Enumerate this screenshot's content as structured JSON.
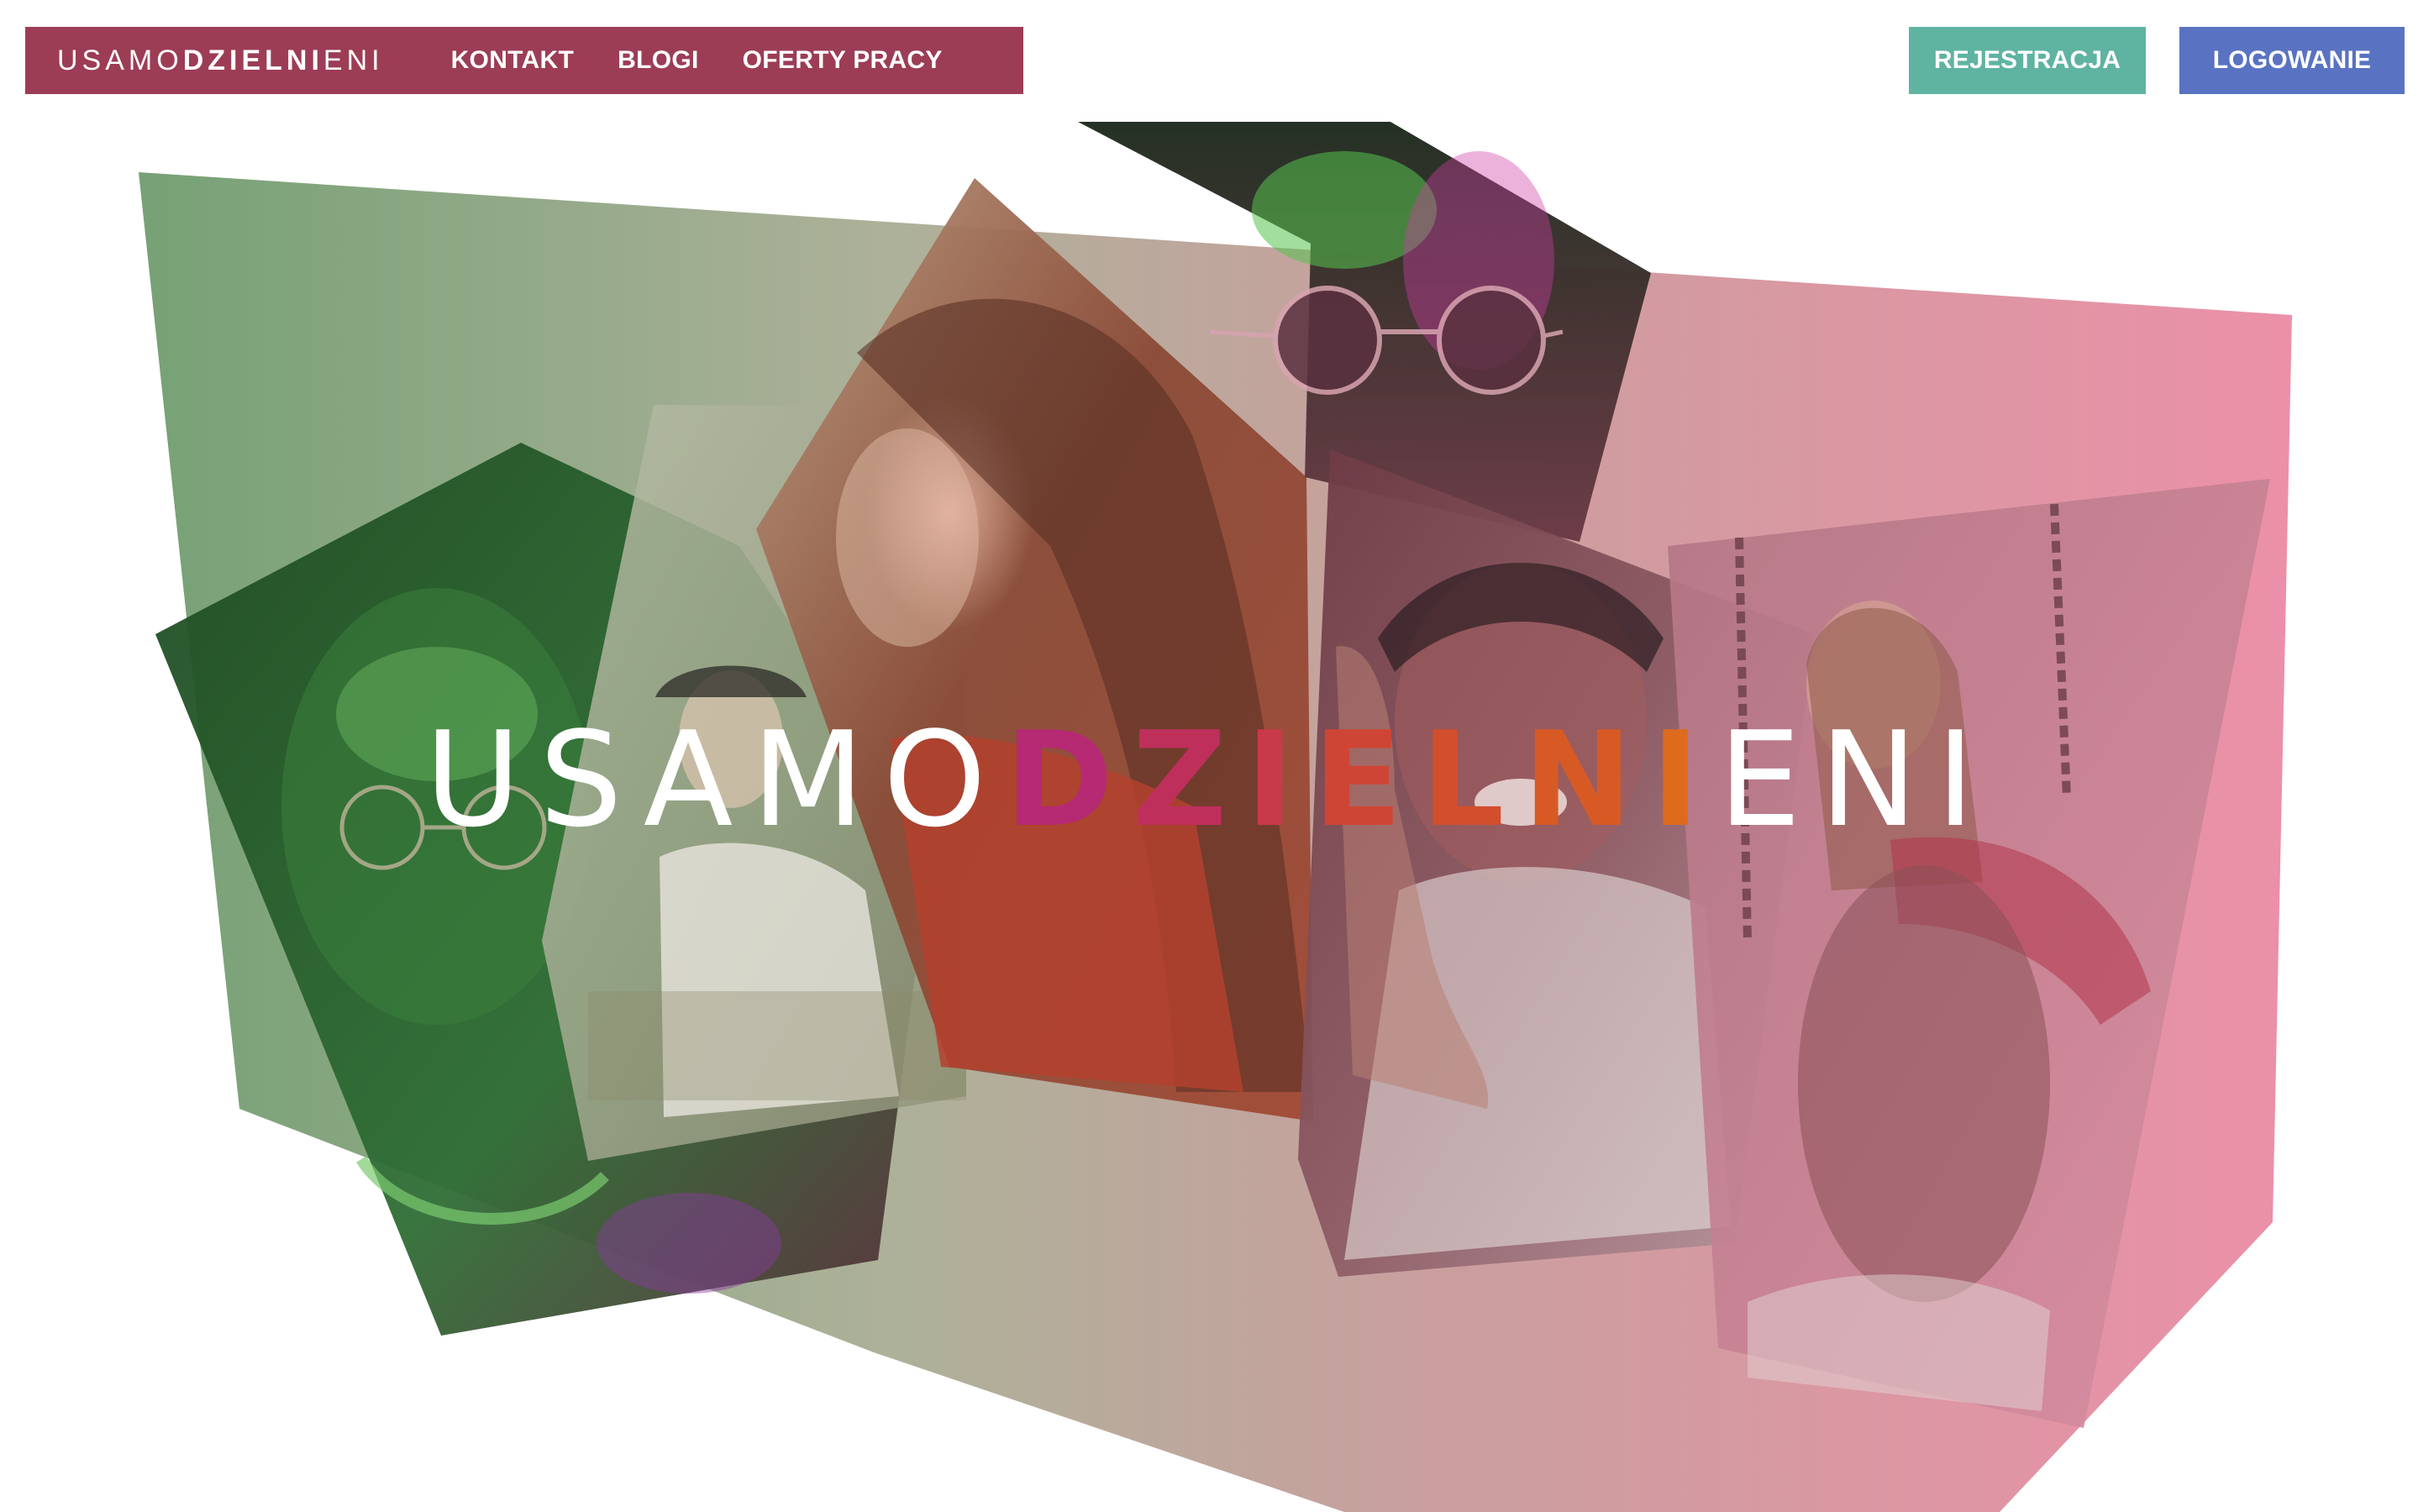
{
  "nav": {
    "logo": {
      "light_start": "USAMO",
      "bold_middle": "DZIELNI",
      "light_end": "ENI"
    },
    "links": [
      "KONTAKT",
      "BLOGI",
      "OFERTY PRACY"
    ],
    "register_label": "REJESTRACJA",
    "login_label": "LOGOWANIE"
  },
  "hero": {
    "title": {
      "light_start": "USAMO",
      "gradient_letters": [
        "D",
        "Z",
        "I",
        "E",
        "L",
        "N",
        "I"
      ],
      "light_end": "ENI"
    },
    "photos": [
      "young-man-sunglasses-photo",
      "woman-with-hat-in-field-photo",
      "two-young-women-profile-photo",
      "man-sunglasses-closeup-photo",
      "smiling-young-man-peace-sign-photo",
      "woman-on-swing-photo"
    ]
  },
  "colors": {
    "nav_bar": "#9c3d55",
    "register_button": "#5fb3a1",
    "login_button": "#5973c2",
    "gradient_start": "#6f9c6e",
    "gradient_end": "#ea8aa3",
    "title_accent_start": "#b52a72",
    "title_accent_end": "#de6a1e"
  }
}
